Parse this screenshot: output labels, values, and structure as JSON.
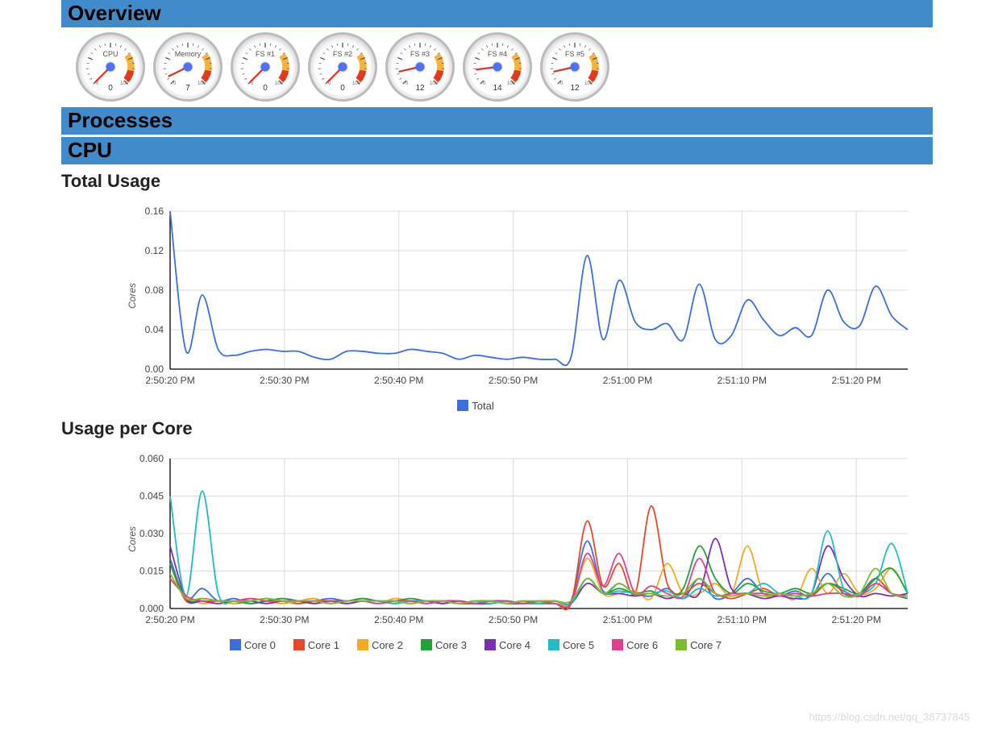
{
  "sections": {
    "overview": "Overview",
    "processes": "Processes",
    "cpu": "CPU"
  },
  "gauges": [
    {
      "label": "CPU",
      "value": 0,
      "display": "0"
    },
    {
      "label": "Memory",
      "value": 7,
      "display": "7"
    },
    {
      "label": "FS #1",
      "value": 0,
      "display": "0"
    },
    {
      "label": "FS #2",
      "value": 0,
      "display": "0"
    },
    {
      "label": "FS #3",
      "value": 12,
      "display": "12"
    },
    {
      "label": "FS #4",
      "value": 14,
      "display": "14"
    },
    {
      "label": "FS #5",
      "value": 12,
      "display": "12"
    }
  ],
  "chart_data": [
    {
      "type": "line",
      "title": "Total Usage",
      "ylabel": "Cores",
      "xlabel": "",
      "ylim": [
        0.0,
        0.16
      ],
      "yticks": [
        0.0,
        0.04,
        0.08,
        0.12,
        0.16
      ],
      "xticks": [
        "2:50:20 PM",
        "2:50:30 PM",
        "2:50:40 PM",
        "2:50:50 PM",
        "2:51:00 PM",
        "2:51:10 PM",
        "2:51:20 PM"
      ],
      "legend": [
        "Total"
      ],
      "series": [
        {
          "name": "Total",
          "color": "#3a6fdc",
          "values": [
            0.16,
            0.018,
            0.075,
            0.02,
            0.014,
            0.018,
            0.02,
            0.018,
            0.018,
            0.012,
            0.01,
            0.018,
            0.018,
            0.016,
            0.016,
            0.02,
            0.018,
            0.016,
            0.01,
            0.014,
            0.012,
            0.01,
            0.012,
            0.01,
            0.01,
            0.012,
            0.115,
            0.03,
            0.09,
            0.048,
            0.04,
            0.046,
            0.03,
            0.086,
            0.03,
            0.034,
            0.07,
            0.05,
            0.034,
            0.042,
            0.034,
            0.08,
            0.048,
            0.044,
            0.084,
            0.054,
            0.04
          ]
        }
      ]
    },
    {
      "type": "line",
      "title": "Usage per Core",
      "ylabel": "Cores",
      "xlabel": "",
      "ylim": [
        0.0,
        0.06
      ],
      "yticks": [
        0.0,
        0.015,
        0.03,
        0.045,
        0.06
      ],
      "xticks": [
        "2:50:20 PM",
        "2:50:30 PM",
        "2:50:40 PM",
        "2:50:50 PM",
        "2:51:00 PM",
        "2:51:10 PM",
        "2:51:20 PM"
      ],
      "legend": [
        "Core 0",
        "Core 1",
        "Core 2",
        "Core 3",
        "Core 4",
        "Core 5",
        "Core 6",
        "Core 7"
      ],
      "colors": {
        "Core 0": "#3a6fdc",
        "Core 1": "#e8472a",
        "Core 2": "#f4a823",
        "Core 3": "#20a238",
        "Core 4": "#7b2fb3",
        "Core 5": "#22bcc9",
        "Core 6": "#e03f8f",
        "Core 7": "#7dbd2c"
      },
      "series": [
        {
          "name": "Core 0",
          "color": "#3a6fdc",
          "values": [
            0.02,
            0.004,
            0.008,
            0.003,
            0.004,
            0.002,
            0.003,
            0.003,
            0.002,
            0.003,
            0.004,
            0.003,
            0.004,
            0.003,
            0.003,
            0.002,
            0.003,
            0.002,
            0.003,
            0.002,
            0.003,
            0.002,
            0.002,
            0.003,
            0.002,
            0.003,
            0.027,
            0.007,
            0.01,
            0.006,
            0.005,
            0.008,
            0.004,
            0.012,
            0.004,
            0.006,
            0.012,
            0.006,
            0.005,
            0.007,
            0.005,
            0.014,
            0.006,
            0.006,
            0.012,
            0.006,
            0.004
          ]
        },
        {
          "name": "Core 1",
          "color": "#e8472a",
          "values": [
            0.018,
            0.003,
            0.004,
            0.003,
            0.002,
            0.003,
            0.004,
            0.003,
            0.002,
            0.003,
            0.003,
            0.002,
            0.003,
            0.003,
            0.002,
            0.003,
            0.002,
            0.003,
            0.002,
            0.002,
            0.003,
            0.002,
            0.003,
            0.002,
            0.002,
            0.002,
            0.035,
            0.009,
            0.018,
            0.006,
            0.041,
            0.01,
            0.006,
            0.01,
            0.006,
            0.004,
            0.006,
            0.008,
            0.005,
            0.006,
            0.005,
            0.01,
            0.007,
            0.005,
            0.012,
            0.006,
            0.005
          ]
        },
        {
          "name": "Core 2",
          "color": "#f4a823",
          "values": [
            0.012,
            0.005,
            0.002,
            0.003,
            0.002,
            0.004,
            0.003,
            0.002,
            0.003,
            0.004,
            0.002,
            0.003,
            0.003,
            0.002,
            0.004,
            0.003,
            0.003,
            0.002,
            0.003,
            0.002,
            0.002,
            0.003,
            0.002,
            0.003,
            0.003,
            0.002,
            0.02,
            0.006,
            0.006,
            0.007,
            0.004,
            0.018,
            0.006,
            0.006,
            0.01,
            0.006,
            0.025,
            0.006,
            0.006,
            0.004,
            0.016,
            0.006,
            0.014,
            0.006,
            0.008,
            0.016,
            0.006
          ]
        },
        {
          "name": "Core 3",
          "color": "#20a238",
          "values": [
            0.018,
            0.004,
            0.003,
            0.003,
            0.003,
            0.002,
            0.003,
            0.004,
            0.003,
            0.002,
            0.003,
            0.003,
            0.004,
            0.003,
            0.003,
            0.004,
            0.003,
            0.003,
            0.002,
            0.003,
            0.003,
            0.002,
            0.003,
            0.002,
            0.003,
            0.002,
            0.012,
            0.006,
            0.008,
            0.006,
            0.007,
            0.004,
            0.008,
            0.025,
            0.012,
            0.006,
            0.01,
            0.007,
            0.006,
            0.008,
            0.006,
            0.01,
            0.008,
            0.006,
            0.012,
            0.016,
            0.006
          ]
        },
        {
          "name": "Core 4",
          "color": "#7b2fb3",
          "values": [
            0.025,
            0.004,
            0.003,
            0.002,
            0.003,
            0.003,
            0.002,
            0.003,
            0.003,
            0.002,
            0.003,
            0.002,
            0.003,
            0.003,
            0.002,
            0.003,
            0.003,
            0.002,
            0.003,
            0.002,
            0.002,
            0.003,
            0.002,
            0.002,
            0.003,
            0.002,
            0.01,
            0.006,
            0.006,
            0.005,
            0.006,
            0.004,
            0.006,
            0.006,
            0.028,
            0.008,
            0.006,
            0.004,
            0.005,
            0.004,
            0.006,
            0.025,
            0.012,
            0.005,
            0.006,
            0.005,
            0.006
          ]
        },
        {
          "name": "Core 5",
          "color": "#22bcc9",
          "values": [
            0.045,
            0.005,
            0.047,
            0.006,
            0.003,
            0.003,
            0.004,
            0.003,
            0.003,
            0.003,
            0.002,
            0.003,
            0.003,
            0.003,
            0.002,
            0.003,
            0.003,
            0.003,
            0.002,
            0.003,
            0.002,
            0.003,
            0.002,
            0.002,
            0.003,
            0.002,
            0.012,
            0.006,
            0.007,
            0.006,
            0.006,
            0.007,
            0.004,
            0.008,
            0.005,
            0.006,
            0.006,
            0.01,
            0.006,
            0.005,
            0.006,
            0.031,
            0.008,
            0.006,
            0.01,
            0.026,
            0.006
          ]
        },
        {
          "name": "Core 6",
          "color": "#e03f8f",
          "values": [
            0.012,
            0.005,
            0.003,
            0.003,
            0.003,
            0.004,
            0.003,
            0.003,
            0.003,
            0.003,
            0.003,
            0.003,
            0.003,
            0.002,
            0.003,
            0.003,
            0.002,
            0.003,
            0.003,
            0.002,
            0.003,
            0.003,
            0.002,
            0.003,
            0.002,
            0.002,
            0.022,
            0.009,
            0.022,
            0.006,
            0.009,
            0.006,
            0.005,
            0.02,
            0.006,
            0.006,
            0.006,
            0.006,
            0.005,
            0.006,
            0.005,
            0.006,
            0.006,
            0.005,
            0.01,
            0.006,
            0.005
          ]
        },
        {
          "name": "Core 7",
          "color": "#7dbd2c",
          "values": [
            0.014,
            0.004,
            0.004,
            0.003,
            0.003,
            0.003,
            0.004,
            0.003,
            0.003,
            0.003,
            0.002,
            0.003,
            0.003,
            0.003,
            0.003,
            0.002,
            0.003,
            0.003,
            0.002,
            0.003,
            0.003,
            0.002,
            0.003,
            0.003,
            0.003,
            0.003,
            0.012,
            0.006,
            0.01,
            0.006,
            0.006,
            0.005,
            0.006,
            0.012,
            0.006,
            0.005,
            0.006,
            0.005,
            0.006,
            0.005,
            0.006,
            0.01,
            0.005,
            0.006,
            0.016,
            0.006,
            0.005
          ]
        }
      ]
    }
  ],
  "watermark": "https://blog.csdn.net/qq_38737845"
}
